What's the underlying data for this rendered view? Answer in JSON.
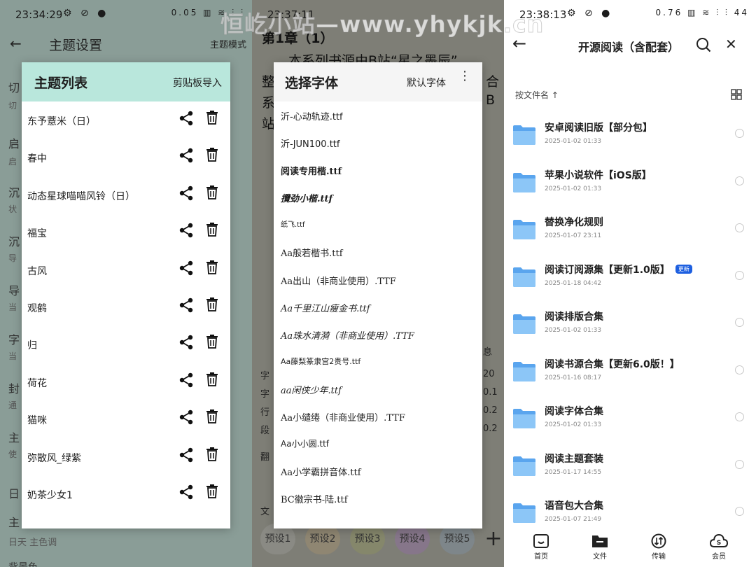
{
  "panel1": {
    "status_time": "23:34:29",
    "status_icons": "⚙ ⊘ ●",
    "status_right": "0.05 ▥ ≋ ⫶ ⫶",
    "bg": {
      "title": "主题设置",
      "mode": "主题模式",
      "rows": [
        "切",
        "启",
        "沉",
        "沉",
        "导",
        "字",
        "封",
        "主",
        "日",
        "主"
      ],
      "subs": [
        "切",
        "启",
        "状",
        "导",
        "当",
        "当",
        "通",
        "使"
      ],
      "bottom_row": "日天  主色调",
      "bottom_cut": "背景色"
    },
    "dialog": {
      "title": "主题列表",
      "import_label": "剪贴板导入",
      "themes": [
        "东予薏米（日）",
        "春中",
        "动态星球喵喵风铃（日）",
        "福宝",
        "古风",
        "观鹤",
        "归",
        "荷花",
        "猫咪",
        "弥散风_绿紫",
        "奶茶少女1"
      ]
    }
  },
  "panel2": {
    "status_time": "23:37:11",
    "bg": {
      "chapter": "第1章（1）",
      "lines": [
        "　　本系列书源由B站“星之墨辰”",
        "整",
        "系",
        "站"
      ],
      "right_cut": [
        "合",
        "B"
      ],
      "left_labels": [
        "字",
        "字",
        "行",
        "段",
        "翻",
        "文"
      ],
      "right_values": [
        "20",
        "0.1",
        "0.2",
        "0.2"
      ],
      "right_tag": "息",
      "presets": [
        "预设1",
        "预设2",
        "预设3",
        "预设4",
        "预设5"
      ],
      "add": "+"
    },
    "dialog": {
      "title": "选择字体",
      "default_label": "默认字体",
      "more": "⋮",
      "fonts": [
        "沂-心动轨迹.ttf",
        "沂-JUN100.ttf",
        "阅读专用楷.ttf",
        "攬劲小楷.ttf",
        "纸飞.ttf",
        "Aa般若楷书.ttf",
        "Aa出山（非商业使用）.TTF",
        "Aa千里江山瘦金书.ttf",
        "Aa珠水清漪（非商业使用）.TTF",
        "Aa藤梨篆隶宫2贵号.ttf",
        "aa闲侠少年.ttf",
        "Aa小缱绻（非商业使用）.TTF",
        "Aa小小圆.ttf",
        "Aa小学霸拼音体.ttf",
        "BC徽宗书-陆.ttf"
      ]
    }
  },
  "panel3": {
    "status_time": "23:38:13",
    "status_right": "0.76 ▥ ≋ ⫶ ⫶ 44",
    "title": "开源阅读（含配套）",
    "sort_label": "按文件名 ↑",
    "folders": [
      {
        "name": "安卓阅读旧版【部分包】",
        "date": "2025-01-02 01:33",
        "badge": ""
      },
      {
        "name": "苹果小说软件【iOS版】",
        "date": "2025-01-02 01:33",
        "badge": ""
      },
      {
        "name": "替换净化规则",
        "date": "2025-01-07 23:11",
        "badge": ""
      },
      {
        "name": "阅读订阅源集【更新1.0版】",
        "date": "2025-01-18 04:42",
        "badge": "更新"
      },
      {
        "name": "阅读排版合集",
        "date": "2025-01-02 01:33",
        "badge": ""
      },
      {
        "name": "阅读书源合集【更新6.0版！】",
        "date": "2025-01-16 08:17",
        "badge": ""
      },
      {
        "name": "阅读字体合集",
        "date": "2025-01-02 01:33",
        "badge": ""
      },
      {
        "name": "阅读主题套装",
        "date": "2025-01-17 14:55",
        "badge": ""
      },
      {
        "name": "语音包大合集",
        "date": "2025-01-07 21:49",
        "badge": ""
      }
    ],
    "nav": [
      "首页",
      "文件",
      "传输",
      "会员"
    ]
  },
  "watermark": "恒屹小站—www.yhykjk.cn",
  "colors": {
    "teal_header": "#b9e7dc",
    "badge_blue": "#1d5fe0",
    "folder_blue": "#6fb3f2"
  }
}
